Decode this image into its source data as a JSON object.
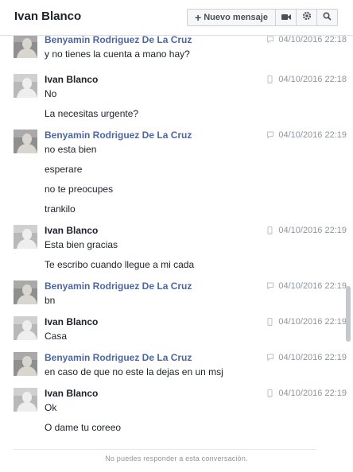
{
  "header": {
    "title": "Ivan Blanco",
    "new_message_label": "Nuevo mensaje"
  },
  "messages": [
    {
      "sender": "Benyamin Rodriguez De La Cruz",
      "sender_style": "blue",
      "time": "04/10/2016 22:18",
      "device": "web",
      "lines": [
        "y no tienes la cuenta a mano hay?"
      ]
    },
    {
      "sender": "Ivan Blanco",
      "sender_style": "dark",
      "time": "04/10/2016 22:18",
      "device": "mobile",
      "lines": [
        "No",
        "La necesitas urgente?"
      ]
    },
    {
      "sender": "Benyamin Rodriguez De La Cruz",
      "sender_style": "blue",
      "time": "04/10/2016 22:19",
      "device": "web",
      "lines": [
        "no esta bien",
        "esperare",
        "no te preocupes",
        "trankilo"
      ]
    },
    {
      "sender": "Ivan Blanco",
      "sender_style": "dark",
      "time": "04/10/2016 22:19",
      "device": "mobile",
      "lines": [
        "Esta bien gracias",
        "Te escribo cuando llegue a mi cada"
      ]
    },
    {
      "sender": "Benyamin Rodriguez De La Cruz",
      "sender_style": "blue",
      "time": "04/10/2016 22:19",
      "device": "web",
      "lines": [
        "bn"
      ]
    },
    {
      "sender": "Ivan Blanco",
      "sender_style": "dark",
      "time": "04/10/2016 22:19",
      "device": "mobile",
      "lines": [
        "Casa"
      ]
    },
    {
      "sender": "Benyamin Rodriguez De La Cruz",
      "sender_style": "blue",
      "time": "04/10/2016 22:19",
      "device": "web",
      "lines": [
        "en caso de que no este la dejas en un msj"
      ]
    },
    {
      "sender": "Ivan Blanco",
      "sender_style": "dark",
      "time": "04/10/2016 22:19",
      "device": "mobile",
      "lines": [
        "Ok",
        "O dame tu coreeo"
      ]
    }
  ],
  "footer": {
    "notice": "No puedes responder a esta conversación."
  },
  "colors": {
    "sender_blue": "#4b67a1",
    "muted": "#90949c"
  },
  "icons": {
    "new_message": "plus-icon",
    "video": "video-camera-icon",
    "settings": "gear-icon",
    "search": "search-icon",
    "web_message": "chat-bubble-icon",
    "mobile_message": "mobile-phone-icon"
  }
}
